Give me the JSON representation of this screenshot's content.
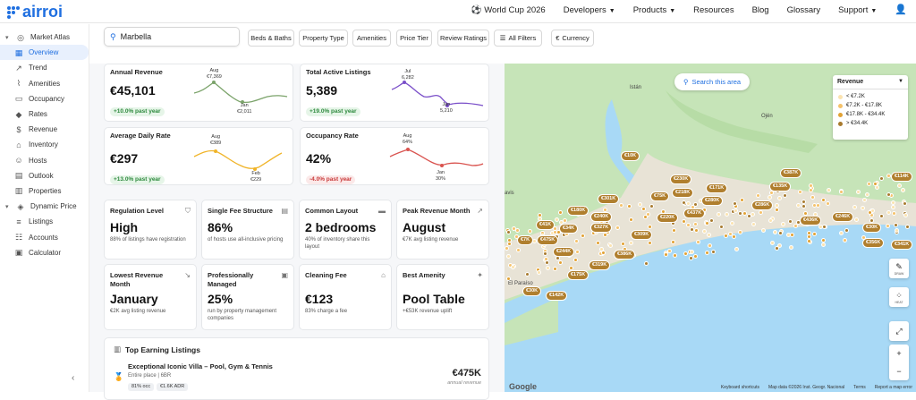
{
  "app": {
    "logo": "airroi"
  },
  "nav": {
    "world_cup": "World Cup 2026",
    "developers": "Developers",
    "products": "Products",
    "resources": "Resources",
    "blog": "Blog",
    "glossary": "Glossary",
    "support": "Support"
  },
  "sidebar": {
    "market_atlas": "Market Atlas",
    "items": [
      "Overview",
      "Trend",
      "Amenities",
      "Occupancy",
      "Rates",
      "Revenue",
      "Inventory",
      "Hosts",
      "Outlook",
      "Properties"
    ],
    "dynamic_price": "Dynamic Price",
    "dp_items": [
      "Listings",
      "Accounts",
      "Calculator"
    ]
  },
  "filters": {
    "search_value": "Marbella",
    "chips": [
      "Beds & Baths",
      "Property Type",
      "Amenities",
      "Price Tier",
      "Review Ratings",
      "All Filters",
      "Currency"
    ]
  },
  "kpis": [
    {
      "title": "Annual Revenue",
      "value": "€45,101",
      "change": "+10.0% past year",
      "hi_label": "Aug",
      "hi_value": "€7,369",
      "lo_label": "Jan",
      "lo_value": "€2,011"
    },
    {
      "title": "Total Active Listings",
      "value": "5,389",
      "change": "+19.0% past year",
      "hi_label": "Jul",
      "hi_value": "6,282",
      "lo_label": "Jan",
      "lo_value": "5,210"
    },
    {
      "title": "Average Daily Rate",
      "value": "€297",
      "change": "+13.0% past year",
      "hi_label": "Aug",
      "hi_value": "€389",
      "lo_label": "Feb",
      "lo_value": "€229"
    },
    {
      "title": "Occupancy Rate",
      "value": "42%",
      "change": "-4.0% past year",
      "hi_label": "Aug",
      "hi_value": "64%",
      "lo_label": "Jan",
      "lo_value": "30%"
    }
  ],
  "colors": {
    "revenue": "#7ba36a",
    "listings": "#7a4fc9",
    "adr": "#f0b429",
    "occupancy": "#d9534f",
    "accent": "#1f6fe0"
  },
  "stats": [
    {
      "title": "Regulation Level",
      "value": "High",
      "sub": "88% of listings have registration",
      "icon": "shield-icon"
    },
    {
      "title": "Single Fee Structure",
      "value": "86%",
      "sub": "of hosts use all-inclusive pricing",
      "icon": "receipt-icon"
    },
    {
      "title": "Common Layout",
      "value": "2 bedrooms",
      "sub": "40% of inventory share this layout",
      "icon": "bed-icon"
    },
    {
      "title": "Peak Revenue Month",
      "value": "August",
      "sub": "€7K avg listing revenue",
      "icon": "trend-up-icon"
    },
    {
      "title": "Lowest Revenue Month",
      "value": "January",
      "sub": "€2K avg listing revenue",
      "icon": "trend-down-icon"
    },
    {
      "title": "Professionally Managed",
      "value": "25%",
      "sub": "run by property management companies",
      "icon": "briefcase-icon"
    },
    {
      "title": "Cleaning Fee",
      "value": "€123",
      "sub": "83% charge a fee",
      "icon": "cleaning-icon"
    },
    {
      "title": "Best Amenity",
      "value": "Pool Table",
      "sub": "+€53K revenue uplift",
      "icon": "sparkle-icon"
    }
  ],
  "top_earning": {
    "title": "Top Earning Listings",
    "listing": {
      "name": "Exceptional Iconic Villa – Pool, Gym & Tennis",
      "sub": "Entire place | 6BR",
      "occ": "81% occ",
      "adr": "€1.6K ADR",
      "price": "€475K",
      "price_sub": "annual revenue"
    }
  },
  "map": {
    "search_area": "Search this area",
    "legend_title": "Revenue",
    "legend": [
      {
        "label": "< €7.2K",
        "color": "#fbe3b0"
      },
      {
        "label": "€7.2K - €17.8K",
        "color": "#f5c26b"
      },
      {
        "label": "€17.8K - €34.4K",
        "color": "#e2a234"
      },
      {
        "label": "> €34.4K",
        "color": "#a87a2e"
      }
    ],
    "places": [
      "Istán",
      "Ojén",
      "avis",
      "El Paraíso"
    ],
    "pins": [
      "€10K",
      "€230K",
      "€387K",
      "€114K",
      "€75K",
      "€218K",
      "€171K",
      "€135K",
      "€301K",
      "€280K",
      "€180K",
      "€240K",
      "€437K",
      "€220K",
      "€286K",
      "€436K",
      "€246K",
      "€41K",
      "€34K",
      "€327K",
      "€309K",
      "€30K",
      "€7K",
      "€475K",
      "€244K",
      "€386K",
      "€356K",
      "€341K",
      "€319K",
      "€175K",
      "€30K",
      "€142K"
    ],
    "controls": {
      "draw": "DRAW",
      "heat": "HEAT"
    },
    "google": "Google",
    "footer": [
      "Keyboard shortcuts",
      "Map data ©2026 Inst. Geogr. Nacional",
      "Terms",
      "Report a map error"
    ]
  }
}
